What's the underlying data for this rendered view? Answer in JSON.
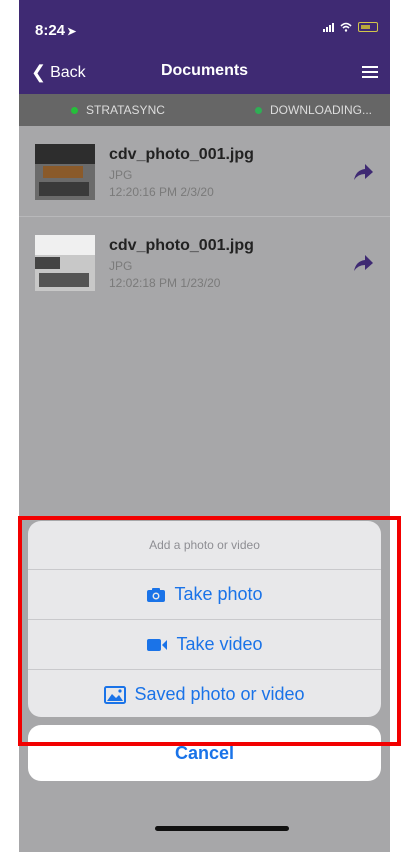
{
  "status": {
    "time": "8:24"
  },
  "nav": {
    "back_label": "Back",
    "title": "Documents"
  },
  "sync": {
    "item1": "STRATASYNC",
    "item2": "DOWNLOADING...",
    "dot1_color": "#25c03a",
    "dot2_color": "#2fae55"
  },
  "files": [
    {
      "name": "cdv_photo_001.jpg",
      "type": "JPG",
      "date": "12:20:16 PM 2/3/20"
    },
    {
      "name": "cdv_photo_001.jpg",
      "type": "JPG",
      "date": "12:02:18 PM 1/23/20"
    }
  ],
  "sheet": {
    "title": "Add a photo or video",
    "options": [
      "Take photo",
      "Take video",
      "Saved photo or video"
    ],
    "cancel_label": "Cancel"
  },
  "colors": {
    "accent": "#1a73e8",
    "nav": "#3f2a73",
    "highlight": "#f20000"
  }
}
